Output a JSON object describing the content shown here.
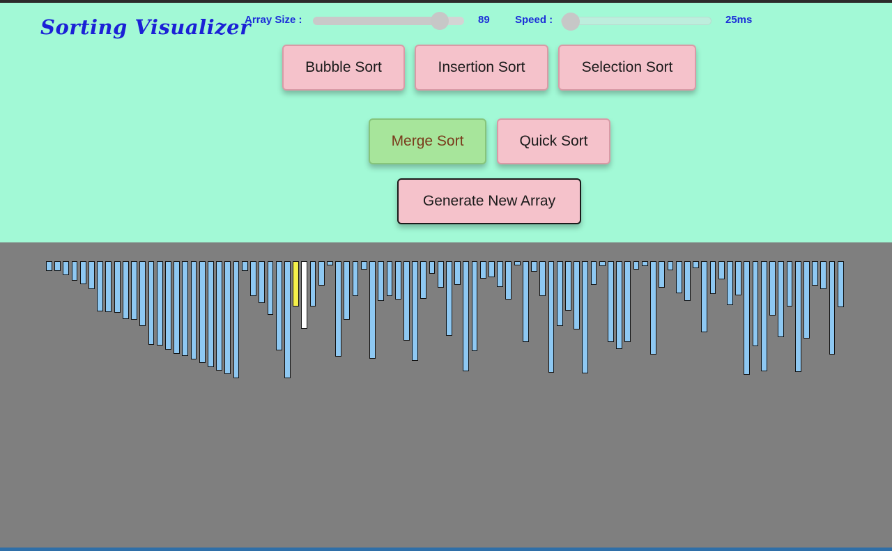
{
  "app": {
    "title": "Sorting Visualizer"
  },
  "controls": {
    "array_size": {
      "label": "Array Size :",
      "value": 89,
      "display": "89",
      "min": 5,
      "max": 100
    },
    "speed": {
      "label": "Speed :",
      "value": 25,
      "display": "25ms",
      "min": 25,
      "max": 1000
    }
  },
  "buttons": {
    "bubble": "Bubble Sort",
    "insertion": "Insertion Sort",
    "selection": "Selection Sort",
    "merge": "Merge Sort",
    "quick": "Quick Sort",
    "generate": "Generate New Array"
  },
  "colors": {
    "header_bg": "#a2f9d6",
    "canvas_bg": "#7f7f7f",
    "bar_default": "#8ec8f2",
    "bar_compare": "#f5f04a",
    "bar_current": "#ffffff",
    "title": "#1b21d6",
    "button_bg": "#f5c2cb",
    "button_active_bg": "#a7e59b"
  },
  "chart_data": {
    "type": "bar",
    "bar_values": [
      14,
      14,
      20,
      28,
      33,
      40,
      72,
      73,
      74,
      83,
      84,
      93,
      120,
      121,
      127,
      133,
      136,
      141,
      146,
      152,
      157,
      162,
      168,
      14,
      50,
      60,
      77,
      128,
      168,
      65,
      97,
      65,
      35,
      6,
      137,
      84,
      50,
      12,
      140,
      57,
      50,
      55,
      114,
      143,
      54,
      18,
      38,
      107,
      34,
      158,
      129,
      25,
      23,
      37,
      55,
      6,
      116,
      15,
      50,
      160,
      93,
      71,
      98,
      161,
      34,
      7,
      116,
      126,
      116,
      12,
      7,
      134,
      38,
      13,
      46,
      57,
      10,
      102,
      47,
      26,
      63,
      49,
      163,
      122,
      158,
      78,
      109,
      65,
      159,
      111,
      35,
      40,
      134,
      66
    ],
    "highlight": {
      "compare_index": 29,
      "current_index": 30
    }
  }
}
